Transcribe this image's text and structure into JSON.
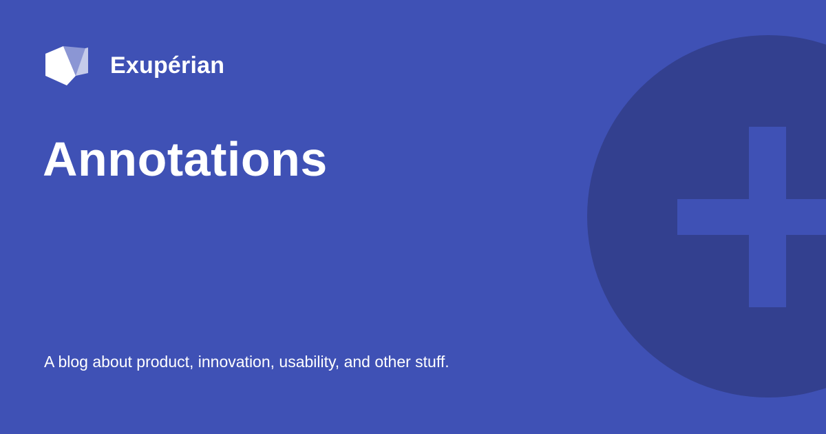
{
  "colors": {
    "background": "#3f51b5",
    "circle": "#33408f",
    "text": "#ffffff"
  },
  "brand": {
    "name": "Exupérian",
    "logo_icon": "exuperian-logo-icon"
  },
  "title": "Annotations",
  "tagline": "A blog about product, innovation, usability, and other stuff.",
  "decoration": {
    "icon": "plus-icon"
  }
}
